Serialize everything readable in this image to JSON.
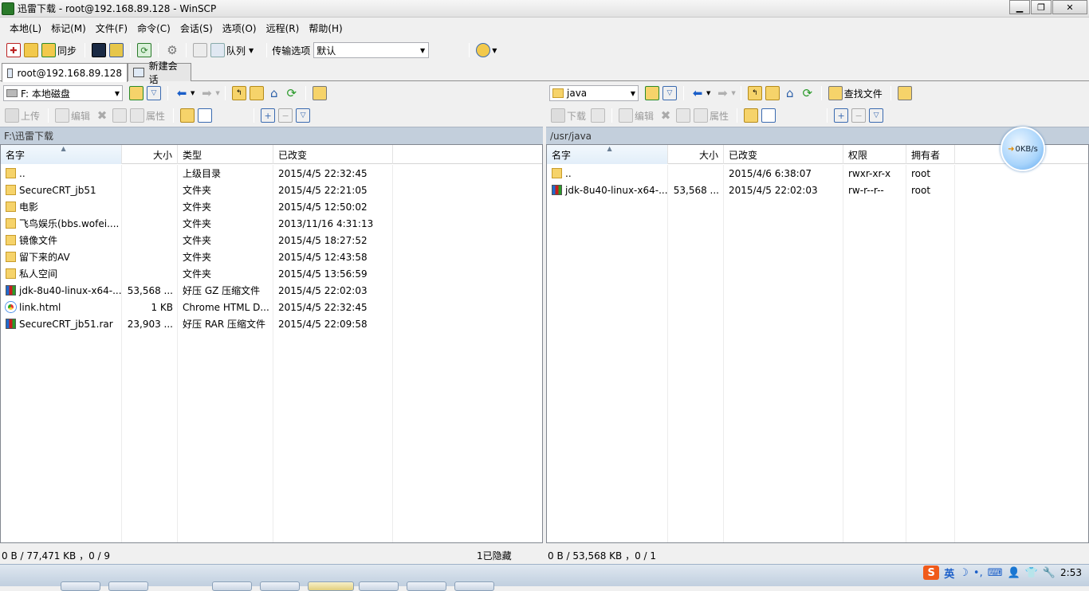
{
  "window": {
    "title": "迅雷下载 - root@192.168.89.128 - WinSCP"
  },
  "menu": [
    "本地(L)",
    "标记(M)",
    "文件(F)",
    "命令(C)",
    "会话(S)",
    "选项(O)",
    "远程(R)",
    "帮助(H)"
  ],
  "toolbar": {
    "sync_label": "同步",
    "queue_label": "队列",
    "transfer_options_label": "传输选项",
    "transfer_preset": "默认"
  },
  "tabs": {
    "session": "root@192.168.89.128",
    "new_session": "新建会话"
  },
  "left_panel": {
    "drive": "F: 本地磁盘",
    "actions": {
      "upload": "上传",
      "edit": "编辑",
      "properties": "属性"
    },
    "path": "F:\\迅雷下载",
    "columns": [
      "名字",
      "大小",
      "类型",
      "已改变"
    ],
    "rows": [
      {
        "name": "..",
        "size": "",
        "type": "上级目录",
        "changed": "2015/4/5  22:32:45",
        "icon": "parent-dir-icon"
      },
      {
        "name": "SecureCRT_jb51",
        "size": "",
        "type": "文件夹",
        "changed": "2015/4/5  22:21:05",
        "icon": "folder-icon"
      },
      {
        "name": "电影",
        "size": "",
        "type": "文件夹",
        "changed": "2015/4/5  12:50:02",
        "icon": "folder-icon"
      },
      {
        "name": "飞鸟娱乐(bbs.wofei....",
        "size": "",
        "type": "文件夹",
        "changed": "2013/11/16  4:31:13",
        "icon": "folder-icon"
      },
      {
        "name": "镜像文件",
        "size": "",
        "type": "文件夹",
        "changed": "2015/4/5  18:27:52",
        "icon": "folder-icon"
      },
      {
        "name": "留下来的AV",
        "size": "",
        "type": "文件夹",
        "changed": "2015/4/5  12:43:58",
        "icon": "folder-icon"
      },
      {
        "name": "私人空间",
        "size": "",
        "type": "文件夹",
        "changed": "2015/4/5  13:56:59",
        "icon": "folder-icon"
      },
      {
        "name": "jdk-8u40-linux-x64-...",
        "size": "53,568 ...",
        "type": "好压 GZ 压缩文件",
        "changed": "2015/4/5  22:02:03",
        "icon": "archive-icon"
      },
      {
        "name": "link.html",
        "size": "1 KB",
        "type": "Chrome HTML D...",
        "changed": "2015/4/5  22:32:45",
        "icon": "chrome-icon"
      },
      {
        "name": "SecureCRT_jb51.rar",
        "size": "23,903 ...",
        "type": "好压 RAR 压缩文件",
        "changed": "2015/4/5  22:09:58",
        "icon": "archive-icon"
      }
    ],
    "status": "0 B / 77,471 KB ，0 / 9",
    "hidden": "1已隐藏"
  },
  "right_panel": {
    "directory": "java",
    "find_files_label": "查找文件",
    "actions": {
      "download": "下载",
      "edit": "编辑",
      "properties": "属性"
    },
    "path": "/usr/java",
    "columns": [
      "名字",
      "大小",
      "已改变",
      "权限",
      "拥有者"
    ],
    "rows": [
      {
        "name": "..",
        "size": "",
        "changed": "2015/4/6 6:38:07",
        "rights": "rwxr-xr-x",
        "owner": "root",
        "icon": "parent-dir-icon"
      },
      {
        "name": "jdk-8u40-linux-x64-...",
        "size": "53,568 ...",
        "changed": "2015/4/5 22:02:03",
        "rights": "rw-r--r--",
        "owner": "root",
        "icon": "archive-icon"
      }
    ],
    "status": "0 B / 53,568 KB ，0 / 1"
  },
  "speed_widget": {
    "value": "0KB/s"
  },
  "tray": {
    "ime": "英",
    "clock": "2:53"
  }
}
